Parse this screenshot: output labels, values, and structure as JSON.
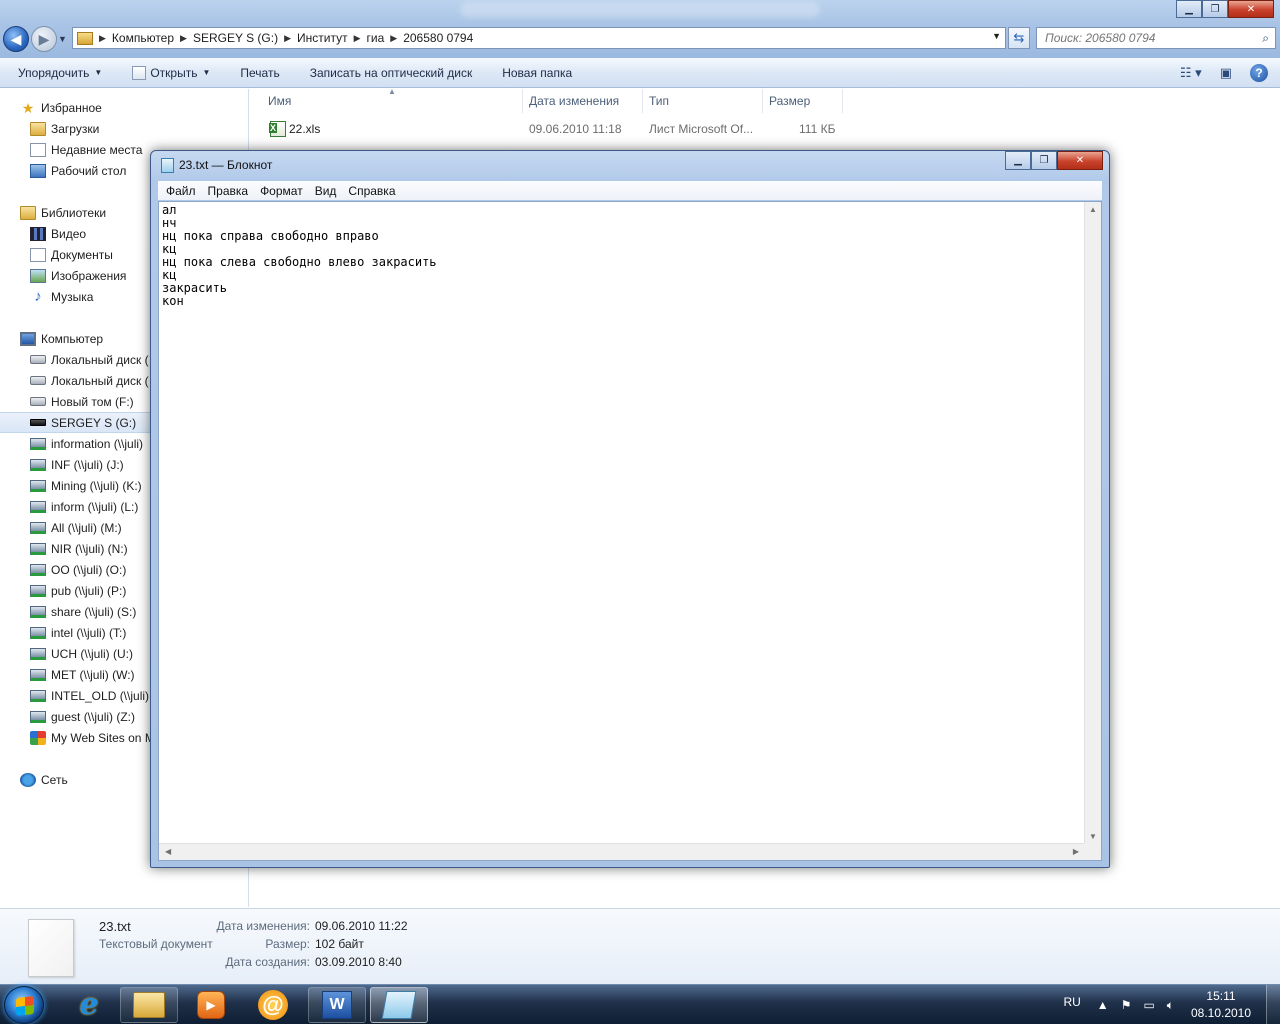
{
  "explorer": {
    "address": [
      "Компьютер",
      "SERGEY S (G:)",
      "Институт",
      "гиа",
      "206580 0794"
    ],
    "search_placeholder": "Поиск: 206580 0794",
    "toolbar": {
      "organize": "Упорядочить",
      "open": "Открыть",
      "print": "Печать",
      "burn": "Записать на оптический диск",
      "new_folder": "Новая папка"
    },
    "nav": {
      "favorites": "Избранное",
      "downloads": "Загрузки",
      "recent": "Недавние места",
      "desktop": "Рабочий стол",
      "libraries": "Библиотеки",
      "video": "Видео",
      "documents": "Документы",
      "images": "Изображения",
      "music": "Музыка",
      "computer": "Компьютер",
      "drives": [
        "Локальный диск (",
        "Локальный диск (",
        "Новый том (F:)",
        "SERGEY S (G:)",
        "information (\\\\juli)",
        "INF (\\\\juli) (J:)",
        "Mining (\\\\juli) (K:)",
        "inform (\\\\juli) (L:)",
        "All (\\\\juli) (M:)",
        "NIR (\\\\juli) (N:)",
        "OO (\\\\juli) (O:)",
        "pub (\\\\juli) (P:)",
        "share (\\\\juli) (S:)",
        "intel (\\\\juli) (T:)",
        "UCH (\\\\juli) (U:)",
        "MET (\\\\juli) (W:)",
        "INTEL_OLD (\\\\juli)",
        "guest (\\\\juli) (Z:)",
        "My Web Sites on M"
      ],
      "network": "Сеть"
    },
    "columns": {
      "name": "Имя",
      "modified": "Дата изменения",
      "type": "Тип",
      "size": "Размер"
    },
    "files": [
      {
        "name": "22.xls",
        "modified": "09.06.2010 11:18",
        "type": "Лист Microsoft Of...",
        "size": "111 КБ"
      }
    ],
    "details": {
      "name": "23.txt",
      "type": "Текстовый документ",
      "modified_label": "Дата изменения:",
      "modified_value": "09.06.2010 11:22",
      "size_label": "Размер:",
      "size_value": "102 байт",
      "created_label": "Дата создания:",
      "created_value": "03.09.2010 8:40"
    }
  },
  "notepad": {
    "title": "23.txt — Блокнот",
    "menu": [
      "Файл",
      "Правка",
      "Формат",
      "Вид",
      "Справка"
    ],
    "content": "ал\nнч\nнц пока справа свободно вправо\nкц\nнц пока слева свободно влево закрасить\nкц\nзакрасить\nкон"
  },
  "taskbar": {
    "lang": "RU",
    "time": "15:11",
    "date": "08.10.2010",
    "word_letter": "W",
    "mail_glyph": "@",
    "ie_glyph": "e"
  }
}
